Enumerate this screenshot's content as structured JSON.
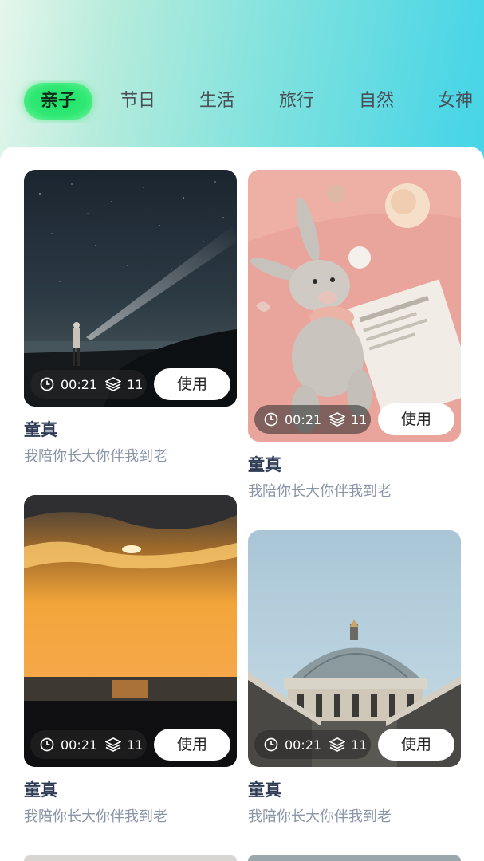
{
  "tabs": [
    {
      "label": "亲子",
      "active": true
    },
    {
      "label": "节日",
      "active": false
    },
    {
      "label": "生活",
      "active": false
    },
    {
      "label": "旅行",
      "active": false
    },
    {
      "label": "自然",
      "active": false
    },
    {
      "label": "女神",
      "active": false
    }
  ],
  "cards": [
    {
      "duration": "00:21",
      "layers": "11",
      "use_label": "使用",
      "title": "童真",
      "subtitle": "我陪你长大你伴我到老",
      "image": "night-sky-flashlight"
    },
    {
      "duration": "00:21",
      "layers": "11",
      "use_label": "使用",
      "title": "童真",
      "subtitle": "我陪你长大你伴我到老",
      "image": "bunny-toy-pink"
    },
    {
      "duration": "00:21",
      "layers": "11",
      "use_label": "使用",
      "title": "童真",
      "subtitle": "我陪你长大你伴我到老",
      "image": "sunset-sea"
    },
    {
      "duration": "00:21",
      "layers": "11",
      "use_label": "使用",
      "title": "童真",
      "subtitle": "我陪你长大你伴我到老",
      "image": "dome-building"
    }
  ],
  "colors": {
    "active_tab": "#2ee872",
    "title": "#2e3b55",
    "subtitle": "#8a95a8"
  }
}
